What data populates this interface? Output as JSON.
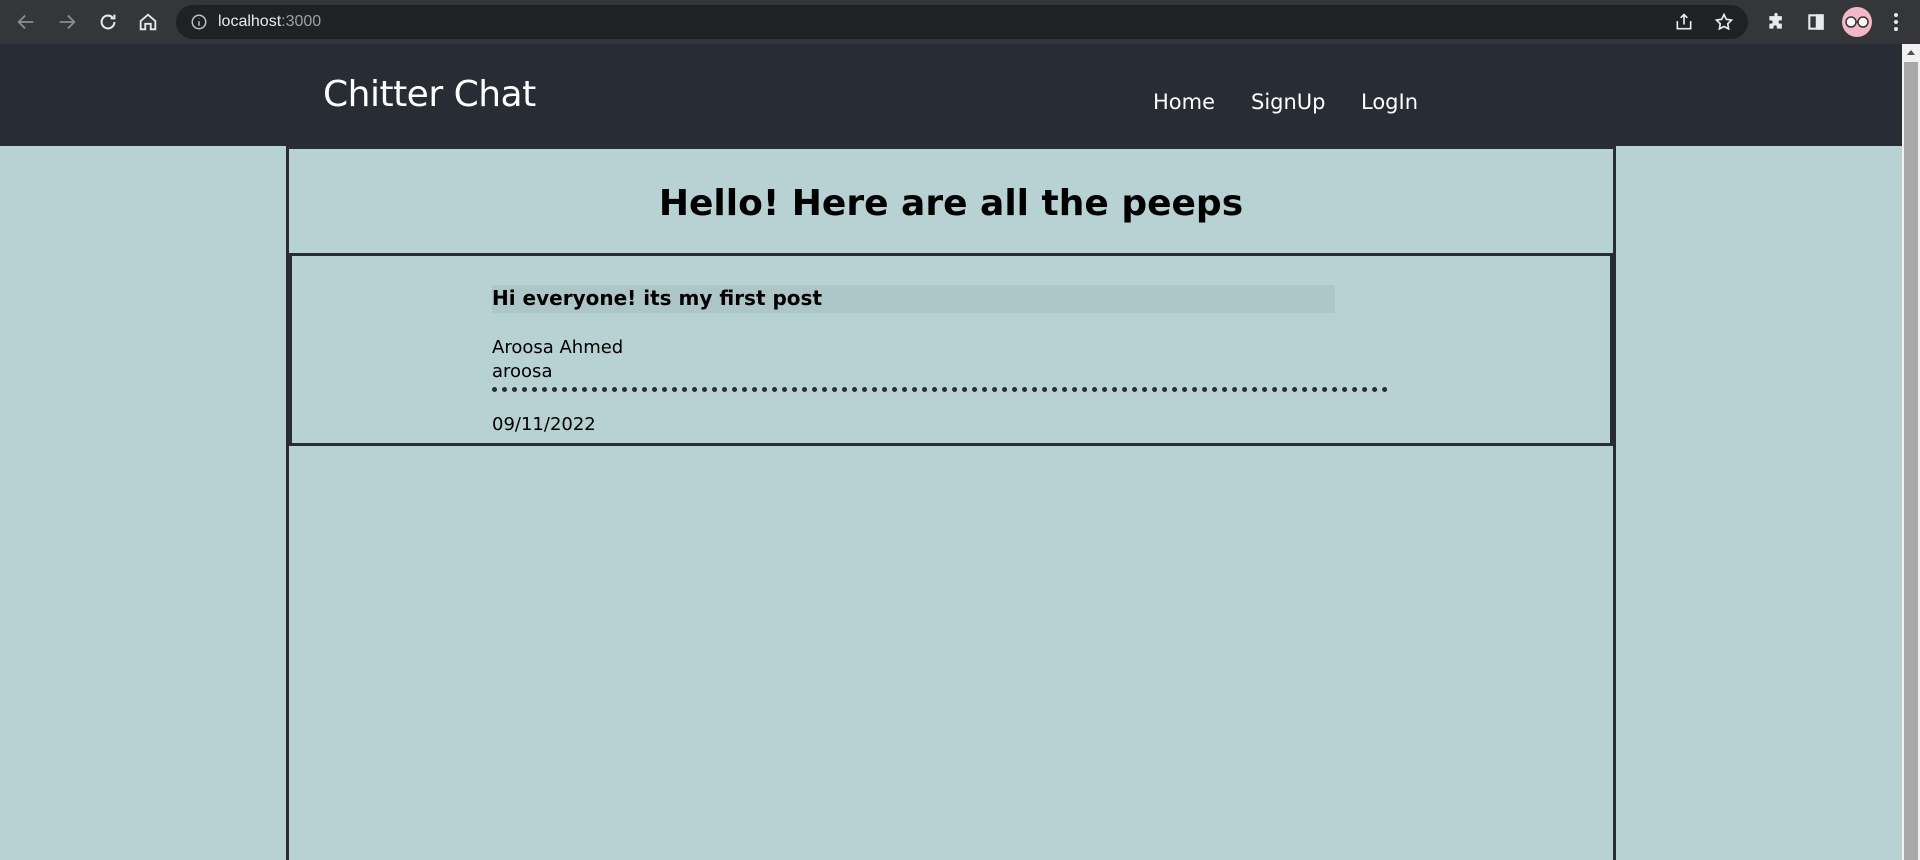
{
  "browser": {
    "url_host": "localhost",
    "url_port": ":3000",
    "icons": [
      "back-icon",
      "forward-icon",
      "reload-icon",
      "home-icon",
      "info-icon",
      "share-icon",
      "star-icon",
      "extensions-icon",
      "side-panel-icon",
      "profile-avatar",
      "menu-icon"
    ]
  },
  "header": {
    "brand": "Chitter Chat",
    "nav": [
      {
        "label": "Home"
      },
      {
        "label": "SignUp"
      },
      {
        "label": "LogIn"
      }
    ]
  },
  "main": {
    "title": "Hello! Here are all the peeps",
    "peeps": [
      {
        "message": "Hi everyone! its my first post",
        "name": "Aroosa Ahmed",
        "username": "aroosa",
        "date": "09/11/2022"
      }
    ]
  },
  "colors": {
    "header_bg": "#272c35",
    "page_bg": "#b8d1d3",
    "message_bg": "#adc6c7"
  }
}
